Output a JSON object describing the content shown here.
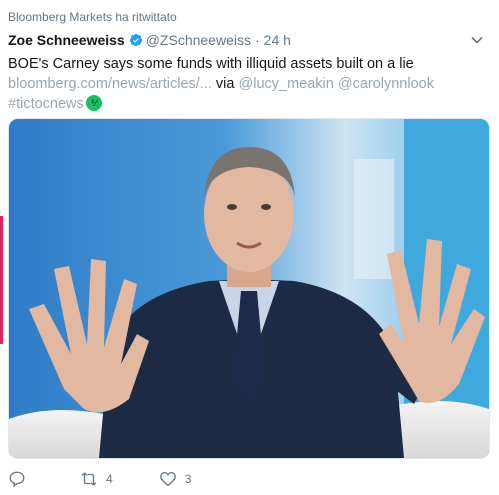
{
  "retweet_context": "Bloomberg Markets ha ritwittato",
  "author": {
    "display_name": "Zoe Schneeweiss",
    "handle": "@ZSchneeweiss",
    "separator": "·",
    "time": "24 h"
  },
  "tweet": {
    "text": "BOE's Carney says some funds with illiquid assets built on a lie",
    "link": "bloomberg.com/news/articles/...",
    "via_label": "via",
    "via_handles": [
      "@lucy_meakin",
      "@carolynnlook"
    ],
    "hashtag": "#tictocnews",
    "hashtag_badge": "⅟"
  },
  "media": {
    "icon": "photo-of-man-gesturing-with-both-hands",
    "colors": {
      "backdrop": "#3e8fd0",
      "suit": "#1c2a44",
      "tie": "#1e2a4a",
      "skin": "#e2b8a0"
    }
  },
  "actions": {
    "reply": {
      "icon": "reply-icon",
      "count": ""
    },
    "retweet": {
      "icon": "retweet-icon",
      "count": "4"
    },
    "like": {
      "icon": "heart-icon",
      "count": "3"
    }
  },
  "colors": {
    "verified": "#1da1f2",
    "secondary": "#657786",
    "link": "#9aa5ae",
    "badge": "#17bf63"
  }
}
